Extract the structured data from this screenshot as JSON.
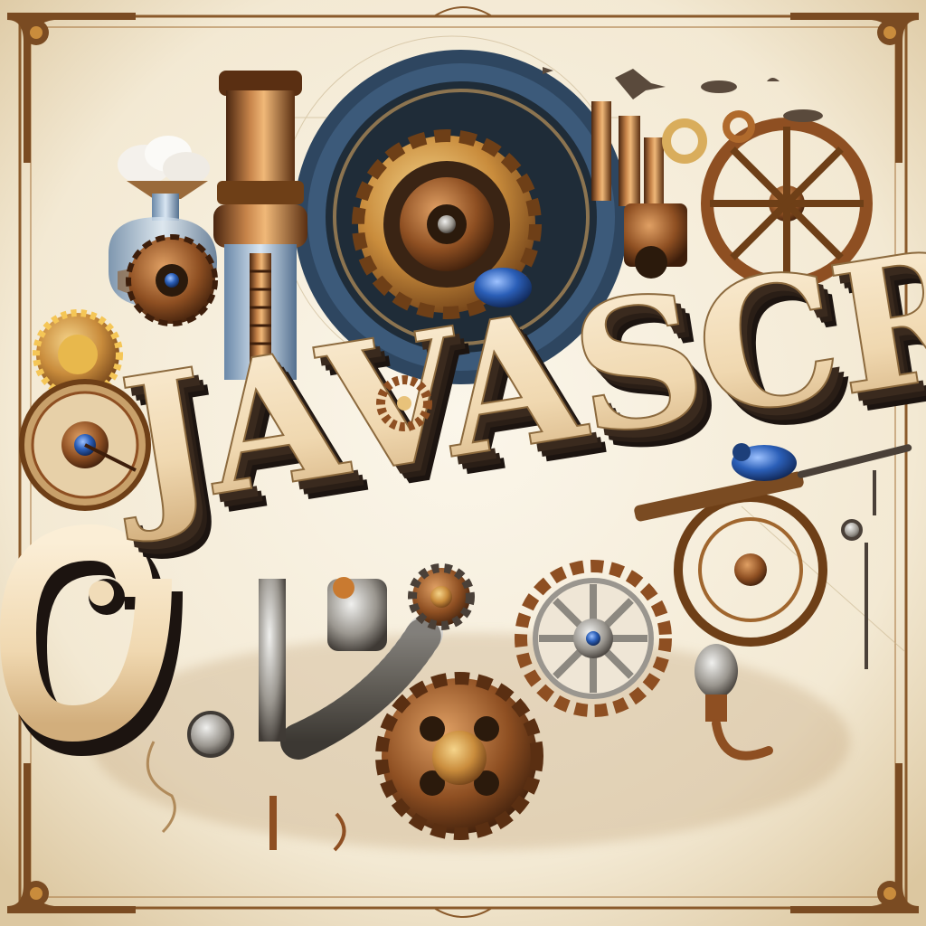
{
  "poster": {
    "title": "JAVASCRIPT",
    "style": "steampunk"
  },
  "colors": {
    "paper": "#f4ecd8",
    "paper_edge": "#e3d2ae",
    "frame": "#8a5a2b",
    "letter_face": "#f1dcb8",
    "letter_shadow": "#1c1410",
    "brass": "#c98c3c",
    "copper": "#8e4f22",
    "iron": "#4a4038",
    "steel_blue": "#3c5a7a",
    "gem_blue": "#2b5fb8"
  },
  "icons": [
    "gear-icon",
    "pipe-icon",
    "flask-icon",
    "beetle-icon",
    "dirigible-icon",
    "wheel-icon",
    "lightbulb-icon",
    "hook-icon"
  ]
}
